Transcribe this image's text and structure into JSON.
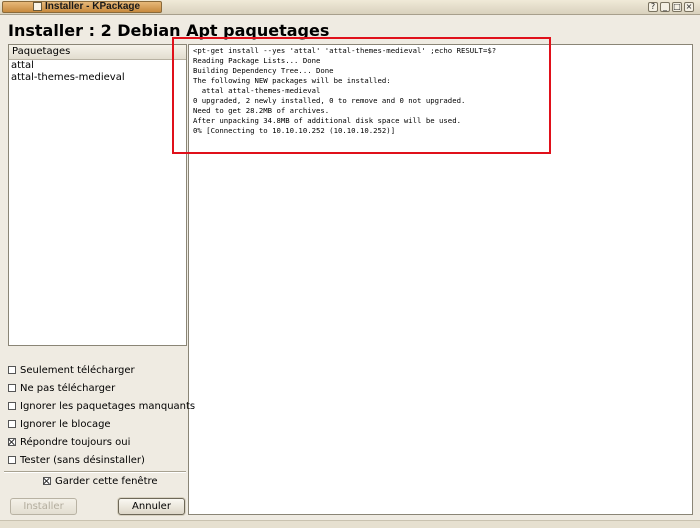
{
  "window": {
    "title": "Installer - KPackage",
    "buttons": [
      "?",
      "_",
      "□",
      "×"
    ]
  },
  "heading": "Installer : 2 Debian Apt paquetages",
  "package_list": {
    "header": "Paquetages",
    "items": [
      "attal",
      "attal-themes-medieval"
    ]
  },
  "terminal": {
    "lines": [
      "<pt-get install --yes 'attal' 'attal-themes-medieval' ;echo RESULT=$?",
      "Reading Package Lists... Done",
      "Building Dependency Tree... Done",
      "The following NEW packages will be installed:",
      "  attal attal-themes-medieval",
      "0 upgraded, 2 newly installed, 0 to remove and 0 not upgraded.",
      "Need to get 28.2MB of archives.",
      "After unpacking 34.8MB of additional disk space will be used.",
      "0% [Connecting to 10.10.10.252 (10.10.10.252)]"
    ],
    "highlight_color": "#e0101a"
  },
  "options": [
    {
      "label": "Seulement télécharger",
      "checked": false
    },
    {
      "label": "Ne pas télécharger",
      "checked": false
    },
    {
      "label": "Ignorer les paquetages manquants",
      "checked": false
    },
    {
      "label": "Ignorer le blocage",
      "checked": false
    },
    {
      "label": "Répondre toujours oui",
      "checked": true
    },
    {
      "label": "Tester (sans désinstaller)",
      "checked": false
    }
  ],
  "keep_window": {
    "label": "Garder cette fenêtre",
    "checked": true
  },
  "buttons": {
    "install": "Installer",
    "cancel": "Annuler"
  }
}
